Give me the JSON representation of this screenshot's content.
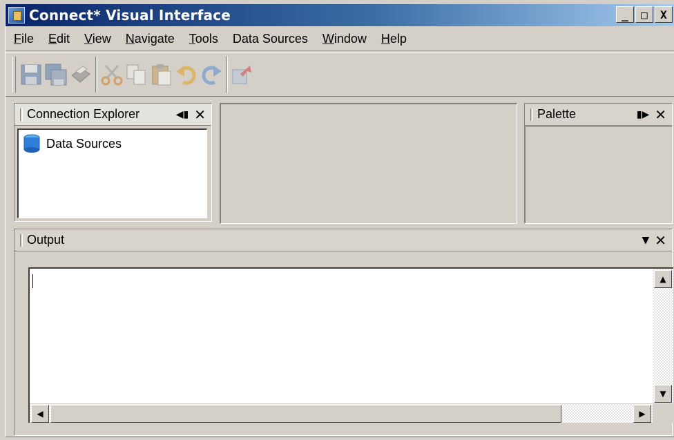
{
  "window": {
    "title": "Connect* Visual Interface",
    "controls": {
      "minimize": "_",
      "maximize": "□",
      "close": "X"
    }
  },
  "menu": [
    {
      "label": "File",
      "mnemonic": "F",
      "rest": "ile"
    },
    {
      "label": "Edit",
      "mnemonic": "E",
      "rest": "dit"
    },
    {
      "label": "View",
      "mnemonic": "V",
      "rest": "iew"
    },
    {
      "label": "Navigate",
      "mnemonic": "N",
      "rest": "avigate"
    },
    {
      "label": "Tools",
      "mnemonic": "T",
      "rest": "ools"
    },
    {
      "label": "Data Sources",
      "mnemonic": "",
      "rest": "Data Sources"
    },
    {
      "label": "Window",
      "mnemonic": "W",
      "rest": "indow"
    },
    {
      "label": "Help",
      "mnemonic": "H",
      "rest": "elp"
    }
  ],
  "toolbar": {
    "buttons": [
      "save-icon",
      "save-all-icon",
      "print-icon",
      "cut-icon",
      "copy-icon",
      "paste-icon",
      "undo-icon",
      "redo-icon",
      "export-icon"
    ]
  },
  "connection_explorer": {
    "title": "Connection Explorer",
    "items": [
      {
        "label": "Data Sources",
        "icon": "database-icon"
      }
    ]
  },
  "palette": {
    "title": "Palette"
  },
  "output": {
    "title": "Output",
    "content": ""
  },
  "colors": {
    "titlebar_start": "#0a246a",
    "titlebar_end": "#a6caf0",
    "chrome": "#d4d0c8"
  }
}
